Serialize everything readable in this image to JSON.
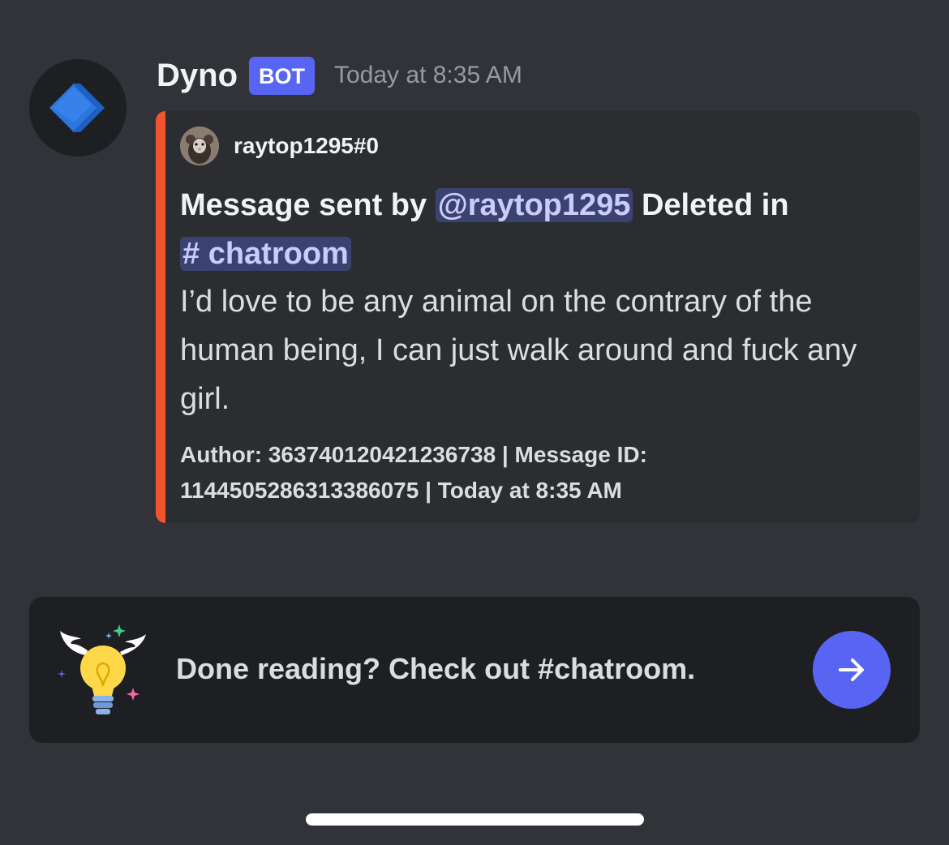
{
  "message": {
    "username": "Dyno",
    "bot_tag": "BOT",
    "timestamp": "Today at 8:35 AM",
    "avatar_icon": "dyno-chevron-logo"
  },
  "embed": {
    "accent_color": "#f2542d",
    "author_name": "raytop1295#0",
    "title_prefix": "Message sent by ",
    "title_mention": "@raytop1295",
    "title_middle": " Deleted in",
    "title_channel": "# chatroom",
    "description": "I’d love to be any animal on the contrary of the human being, I can just walk around and fuck any girl.",
    "footer_line1": "Author: 363740120421236738 | Message ID:",
    "footer_line2": "1144505286313386075 | Today at 8:35 AM"
  },
  "cta": {
    "text": "Done reading? Check out #chatroom.",
    "icon": "winged-lightbulb-icon",
    "button_icon": "arrow-right-icon",
    "button_color": "#5865f2"
  }
}
